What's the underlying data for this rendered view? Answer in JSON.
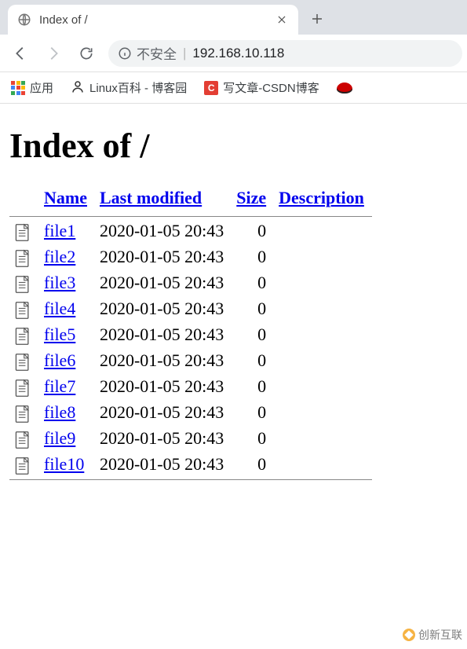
{
  "browser": {
    "tab_title": "Index of /",
    "url": "192.168.10.118",
    "insecure_label": "不安全",
    "bookmarks": {
      "apps_label": "应用",
      "linux_label": "Linux百科 - 博客园",
      "csdn_label": "写文章-CSDN博客"
    }
  },
  "page": {
    "heading": "Index of /",
    "columns": {
      "name": "Name",
      "last_modified": "Last modified",
      "size": "Size",
      "description": "Description"
    },
    "files": [
      {
        "name": "file1",
        "modified": "2020-01-05 20:43",
        "size": "0"
      },
      {
        "name": "file2",
        "modified": "2020-01-05 20:43",
        "size": "0"
      },
      {
        "name": "file3",
        "modified": "2020-01-05 20:43",
        "size": "0"
      },
      {
        "name": "file4",
        "modified": "2020-01-05 20:43",
        "size": "0"
      },
      {
        "name": "file5",
        "modified": "2020-01-05 20:43",
        "size": "0"
      },
      {
        "name": "file6",
        "modified": "2020-01-05 20:43",
        "size": "0"
      },
      {
        "name": "file7",
        "modified": "2020-01-05 20:43",
        "size": "0"
      },
      {
        "name": "file8",
        "modified": "2020-01-05 20:43",
        "size": "0"
      },
      {
        "name": "file9",
        "modified": "2020-01-05 20:43",
        "size": "0"
      },
      {
        "name": "file10",
        "modified": "2020-01-05 20:43",
        "size": "0"
      }
    ]
  },
  "watermark": "创新互联"
}
